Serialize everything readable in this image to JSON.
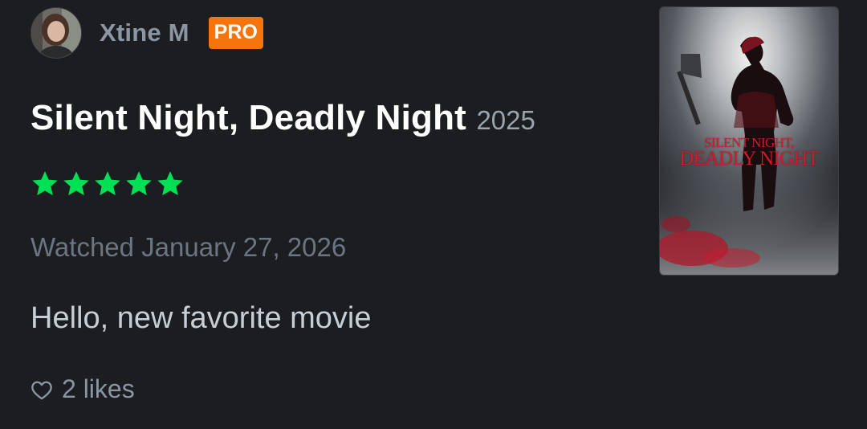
{
  "author": {
    "name": "Xtine M",
    "badge": "PRO"
  },
  "movie": {
    "title": "Silent Night, Deadly Night",
    "year": "2025",
    "poster_title_line1": "SILENT NIGHT,",
    "poster_title_line2": "DEADLY NIGHT"
  },
  "review": {
    "rating_stars": 5,
    "rating_max": 5,
    "watched": "Watched January 27, 2026",
    "text": "Hello, new favorite movie",
    "likes": "2 likes"
  },
  "colors": {
    "background": "#1b1d21",
    "star": "#00e054",
    "pro_badge": "#f5740c",
    "poster_title": "#d11a2a"
  },
  "icons": {
    "avatar": "user-avatar",
    "star": "star-icon",
    "heart": "heart-outline-icon"
  }
}
